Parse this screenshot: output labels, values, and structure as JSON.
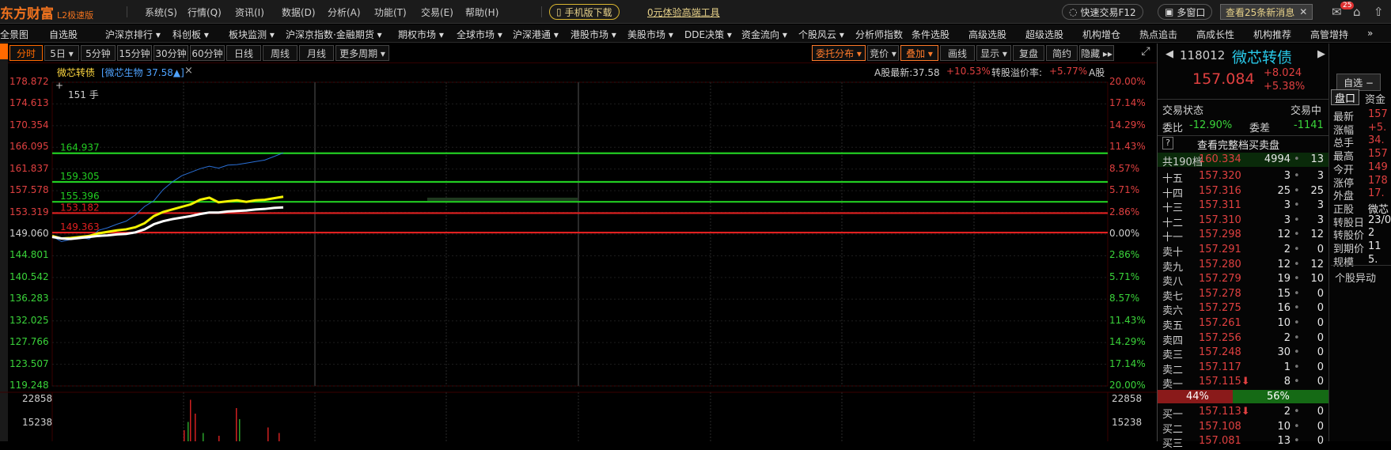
{
  "app": {
    "brand": "东方财富",
    "edition": "L2极速版"
  },
  "menu": [
    "系统(S)",
    "行情(Q)",
    "资讯(I)",
    "数据(D)",
    "分析(A)",
    "功能(T)",
    "交易(E)",
    "帮助(H)"
  ],
  "mobile_download": "手机版下载",
  "promo_link": "0元体验高端工具",
  "quick_trade": "快速交易F12",
  "multi_window": "多窗口",
  "news_button": "查看25条新消息",
  "mail_badge": "25",
  "nav": [
    "全景图",
    "自选股",
    "沪深京排行 ▾",
    "科创板 ▾",
    "板块监测 ▾",
    "沪深京指数·金融期货 ▾",
    "期权市场 ▾",
    "全球市场 ▾",
    "沪深港通 ▾",
    "港股市场 ▾",
    "美股市场 ▾",
    "DDE决策 ▾",
    "资金流向 ▾",
    "个股风云 ▾",
    "分析师指数",
    "条件选股",
    "高级选股",
    "超级选股",
    "机构增仓",
    "热点追击",
    "高成长性",
    "机构推荐",
    "高管增持",
    "»"
  ],
  "toolbar": {
    "periods": [
      "分时",
      "5日 ▾",
      "5分钟",
      "15分钟",
      "30分钟",
      "60分钟",
      "日线",
      "周线",
      "月线",
      "更多周期 ▾"
    ],
    "right": [
      "委托分布 ▾",
      "竞价 ▾",
      "叠加 ▾",
      "画线",
      "显示 ▾",
      "复盘",
      "简约",
      "隐藏 ▸▸"
    ]
  },
  "chart_info": {
    "name": "微芯转债",
    "overlay": "[微芯生物 37.58▲]",
    "close_x": "×",
    "a_share": "A股最新:37.58",
    "a_pct": "+10.53%",
    "premium_label": "转股溢价率:",
    "premium": "+5.77%",
    "a_tail": "A股",
    "hand": "151 手"
  },
  "chart_data": {
    "type": "line",
    "title": "微芯转债",
    "y_axis_left": [
      "178.872",
      "174.613",
      "170.354",
      "166.095",
      "161.837",
      "157.578",
      "153.319",
      "149.060",
      "144.801",
      "140.542",
      "136.283",
      "132.025",
      "127.766",
      "123.507",
      "119.248"
    ],
    "y_axis_right": [
      "20.00%",
      "17.14%",
      "14.29%",
      "11.43%",
      "8.57%",
      "5.71%",
      "2.86%",
      "0.00%",
      "2.86%",
      "5.71%",
      "8.57%",
      "11.43%",
      "14.29%",
      "17.14%",
      "20.00%"
    ],
    "ylim": [
      119.248,
      178.872
    ],
    "prev_close": 149.06,
    "reference_lines": [
      {
        "value": 164.937,
        "color": "#22cc22"
      },
      {
        "value": 159.305,
        "color": "#22cc22"
      },
      {
        "value": 155.396,
        "color": "#22cc22"
      },
      {
        "value": 153.182,
        "color": "#e02020"
      },
      {
        "value": 149.363,
        "color": "#e02020"
      }
    ],
    "series": [
      {
        "color": "#2a6fd6",
        "values": [
          148.6,
          147.6,
          148.0,
          148.4,
          148.1,
          149.8,
          150.3,
          151.0,
          151.6,
          152.8,
          154.5,
          155.6,
          157.8,
          159.3,
          160.5,
          161.2,
          161.9,
          162.4,
          162.0,
          162.6,
          162.7,
          163.0,
          163.3,
          163.6,
          164.3,
          165.0
        ]
      },
      {
        "color": "#f2f200",
        "values": [
          148.7,
          148.2,
          148.3,
          148.5,
          148.7,
          149.2,
          149.5,
          149.8,
          150.0,
          150.4,
          151.2,
          152.6,
          153.4,
          153.9,
          154.4,
          154.9,
          155.8,
          156.2,
          155.3,
          155.5,
          155.7,
          155.4,
          155.7,
          155.8,
          156.1,
          156.4
        ]
      },
      {
        "color": "#ffffff",
        "values": [
          148.5,
          148.2,
          148.1,
          148.3,
          148.5,
          148.7,
          148.8,
          149.0,
          149.1,
          149.4,
          150.0,
          151.0,
          151.6,
          152.0,
          152.3,
          152.6,
          153.0,
          153.3,
          153.3,
          153.5,
          153.6,
          153.7,
          153.9,
          154.0,
          154.2,
          154.3
        ]
      }
    ],
    "volume_axis": [
      "22858",
      "15238"
    ],
    "volume_bars": [
      0.2,
      0.35,
      0.75,
      0.5,
      0.15,
      0.1,
      0.6,
      0.4,
      0.25,
      0.15
    ]
  },
  "quote": {
    "code": "118012",
    "name": "微芯转债",
    "price": "157.084",
    "change": "+8.024",
    "pct": "+5.38%",
    "watch_btn": "自选 −",
    "trade_status_label": "交易状态",
    "trade_status": "交易中",
    "wb_label": "委比",
    "wb": "-12.90%",
    "wc_label": "委差",
    "wc": "-1141",
    "full_book": "查看完整档买卖盘",
    "q_mark": "?",
    "total": {
      "label": "共190档",
      "price": "160.334",
      "vol": "4994",
      "num": "13"
    },
    "asks": [
      {
        "label": "十五",
        "price": "157.320",
        "vol": "3",
        "num": "3"
      },
      {
        "label": "十四",
        "price": "157.316",
        "vol": "25",
        "num": "25"
      },
      {
        "label": "十三",
        "price": "157.311",
        "vol": "3",
        "num": "3"
      },
      {
        "label": "十二",
        "price": "157.310",
        "vol": "3",
        "num": "3"
      },
      {
        "label": "十一",
        "price": "157.298",
        "vol": "12",
        "num": "12"
      },
      {
        "label": "卖十",
        "price": "157.291",
        "vol": "2",
        "num": "0"
      },
      {
        "label": "卖九",
        "price": "157.280",
        "vol": "12",
        "num": "12"
      },
      {
        "label": "卖八",
        "price": "157.279",
        "vol": "19",
        "num": "10"
      },
      {
        "label": "卖七",
        "price": "157.278",
        "vol": "15",
        "num": "0"
      },
      {
        "label": "卖六",
        "price": "157.275",
        "vol": "16",
        "num": "0"
      },
      {
        "label": "卖五",
        "price": "157.261",
        "vol": "10",
        "num": "0"
      },
      {
        "label": "卖四",
        "price": "157.256",
        "vol": "2",
        "num": "0"
      },
      {
        "label": "卖三",
        "price": "157.248",
        "vol": "30",
        "num": "0"
      },
      {
        "label": "卖二",
        "price": "157.117",
        "vol": "1",
        "num": "0"
      },
      {
        "label": "卖一",
        "price": "157.115⬇",
        "vol": "8",
        "num": "0"
      }
    ],
    "ratio_left": "44%",
    "ratio_right": "56%",
    "bids": [
      {
        "label": "买一",
        "price": "157.113⬇",
        "vol": "2",
        "num": "0"
      },
      {
        "label": "买二",
        "price": "157.108",
        "vol": "10",
        "num": "0"
      },
      {
        "label": "买三",
        "price": "157.081",
        "vol": "13",
        "num": "0"
      }
    ],
    "tabs": [
      "盘口",
      "资金"
    ],
    "stats": [
      {
        "k": "最新",
        "v": "157"
      },
      {
        "k": "涨幅",
        "v": "+5."
      },
      {
        "k": "总手",
        "v": "34."
      },
      {
        "k": "最高",
        "v": "157"
      },
      {
        "k": "今开",
        "v": "149"
      },
      {
        "k": "涨停",
        "v": "178"
      },
      {
        "k": "外盘",
        "v": "17."
      },
      {
        "k": "正股",
        "v": "微芯"
      },
      {
        "k": "转股日",
        "v": "23/0"
      },
      {
        "k": "转股价",
        "v": "2"
      },
      {
        "k": "到期价",
        "v": "11"
      },
      {
        "k": "规模",
        "v": "5."
      }
    ],
    "abnormal": "个股异动"
  }
}
